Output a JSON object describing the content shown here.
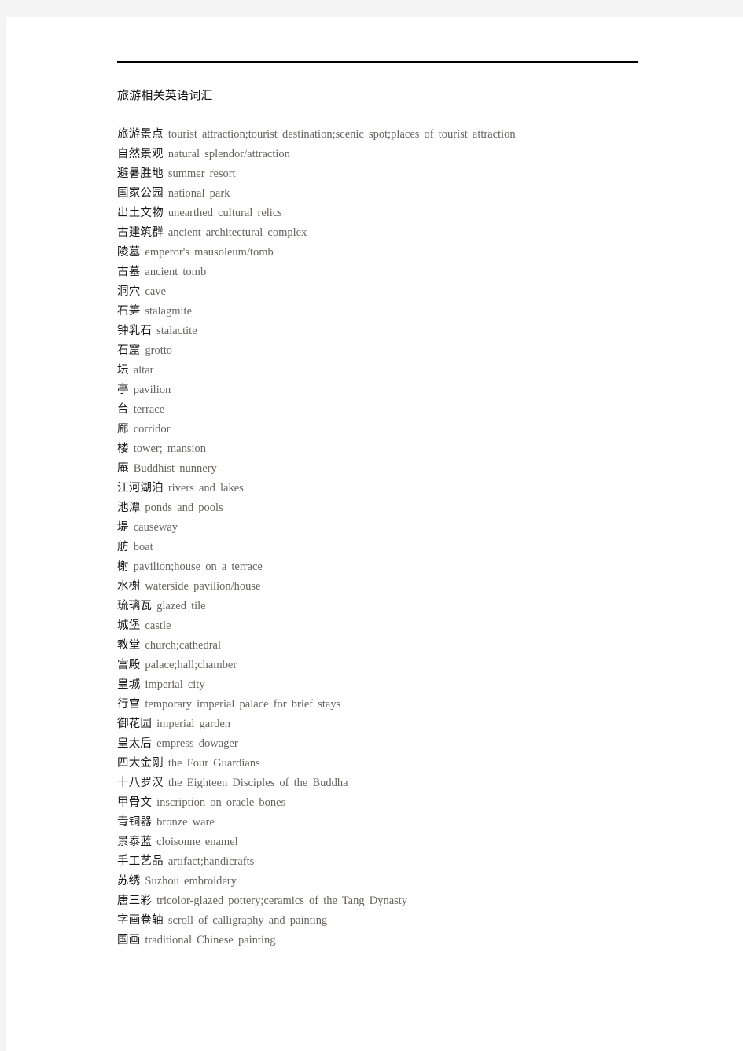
{
  "document": {
    "title": "旅游相关英语词汇",
    "rule": "horizontal-rule",
    "entries": [
      {
        "zh": "旅游景点",
        "en": "tourist attraction;tourist destination;scenic spot;places of tourist attraction"
      },
      {
        "zh": "自然景观",
        "en": "natural splendor/attraction"
      },
      {
        "zh": "避暑胜地",
        "en": "summer resort"
      },
      {
        "zh": "国家公园",
        "en": "national park"
      },
      {
        "zh": "出土文物",
        "en": "unearthed cultural relics"
      },
      {
        "zh": "古建筑群",
        "en": "ancient architectural complex"
      },
      {
        "zh": "陵墓",
        "en": "emperor's mausoleum/tomb"
      },
      {
        "zh": "古墓",
        "en": "ancient tomb"
      },
      {
        "zh": "洞穴",
        "en": "cave"
      },
      {
        "zh": "石笋",
        "en": "stalagmite"
      },
      {
        "zh": "钟乳石",
        "en": "stalactite"
      },
      {
        "zh": "石窟",
        "en": "grotto"
      },
      {
        "zh": "坛",
        "en": "altar"
      },
      {
        "zh": "亭",
        "en": "pavilion"
      },
      {
        "zh": "台",
        "en": "terrace"
      },
      {
        "zh": "廊",
        "en": "corridor"
      },
      {
        "zh": "楼",
        "en": "tower; mansion"
      },
      {
        "zh": "庵",
        "en": "Buddhist nunnery"
      },
      {
        "zh": "江河湖泊",
        "en": "rivers and lakes"
      },
      {
        "zh": "池潭",
        "en": "ponds and pools"
      },
      {
        "zh": "堤",
        "en": "causeway"
      },
      {
        "zh": "舫",
        "en": "boat"
      },
      {
        "zh": "榭",
        "en": "pavilion;house on a terrace"
      },
      {
        "zh": "水榭",
        "en": "waterside pavilion/house"
      },
      {
        "zh": "琉璃瓦",
        "en": "glazed tile"
      },
      {
        "zh": "城堡",
        "en": "castle"
      },
      {
        "zh": "教堂",
        "en": "church;cathedral"
      },
      {
        "zh": "宫殿",
        "en": "palace;hall;chamber"
      },
      {
        "zh": "皇城",
        "en": "imperial city"
      },
      {
        "zh": "行宫",
        "en": "temporary imperial palace for brief stays"
      },
      {
        "zh": "御花园",
        "en": "imperial garden"
      },
      {
        "zh": "皇太后",
        "en": "empress dowager"
      },
      {
        "zh": "四大金刚",
        "en": "the Four Guardians"
      },
      {
        "zh": "十八罗汉",
        "en": "the Eighteen Disciples of the Buddha"
      },
      {
        "zh": "甲骨文",
        "en": "inscription on oracle bones"
      },
      {
        "zh": "青铜器",
        "en": "bronze ware"
      },
      {
        "zh": "景泰蓝",
        "en": "cloisonne enamel"
      },
      {
        "zh": "手工艺品",
        "en": "artifact;handicrafts"
      },
      {
        "zh": "苏绣",
        "en": "Suzhou embroidery"
      },
      {
        "zh": "唐三彩",
        "en": "tricolor-glazed pottery;ceramics of the Tang Dynasty"
      },
      {
        "zh": "字画卷轴",
        "en": "scroll of calligraphy and painting"
      },
      {
        "zh": "国画",
        "en": "traditional Chinese painting"
      }
    ]
  },
  "colors": {
    "page_background": "#ffffff",
    "outer_background": "#f4f4f4",
    "chinese_text": "#1a1a1a",
    "english_text": "#666361",
    "rule": "#000000"
  }
}
